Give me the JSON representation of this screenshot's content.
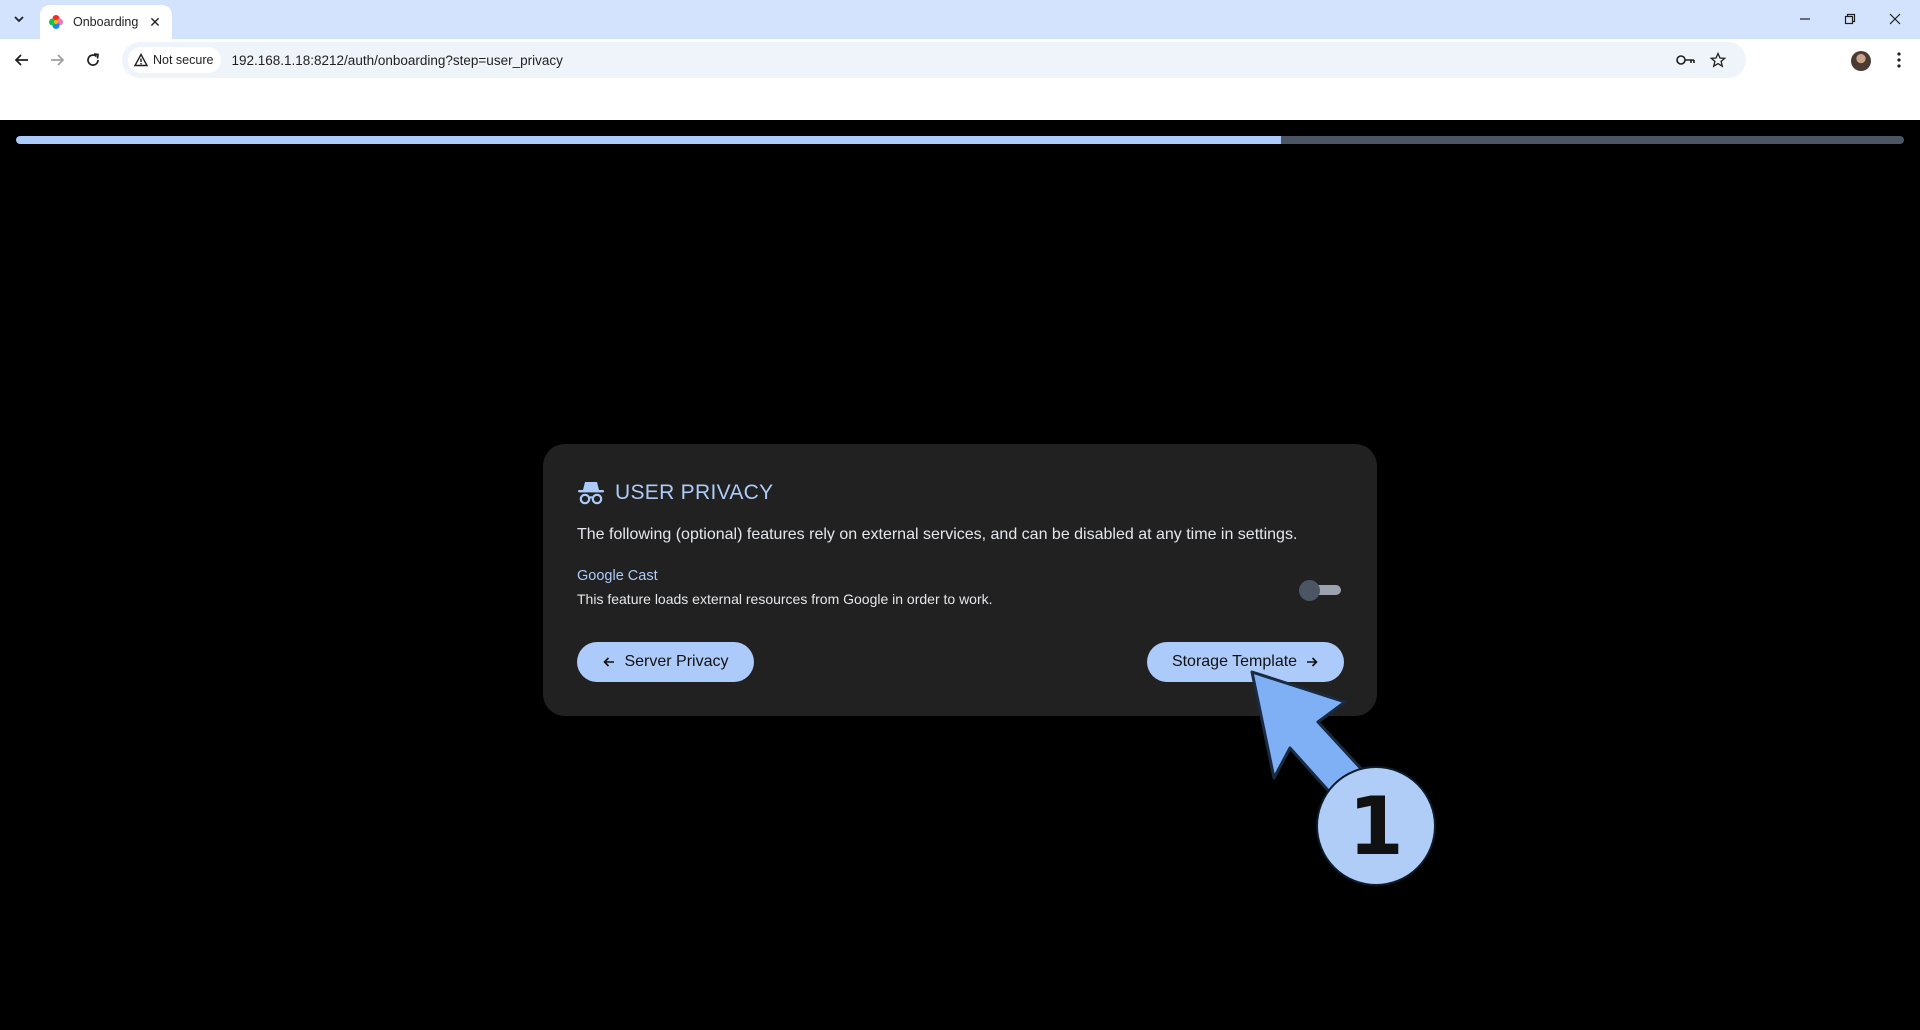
{
  "browser": {
    "tab_title": "Onboarding",
    "security_label": "Not secure",
    "url": "192.168.1.18:8212/auth/onboarding?step=user_privacy"
  },
  "onboarding": {
    "progress_percent": 67,
    "card": {
      "title": "USER PRIVACY",
      "description": "The following (optional) features rely on external services, and can be disabled at any time in settings.",
      "feature": {
        "name": "Google Cast",
        "description": "This feature loads external resources from Google in order to work.",
        "enabled": false
      },
      "back_button_label": "Server Privacy",
      "next_button_label": "Storage Template",
      "back_icon": "arrow-left-icon",
      "next_icon": "arrow-right-icon",
      "title_icon": "incognito-icon"
    }
  },
  "annotation": {
    "step_number": "1"
  },
  "colors": {
    "accent": "#adcbfa",
    "card_bg": "#212121",
    "page_bg": "#000000"
  }
}
